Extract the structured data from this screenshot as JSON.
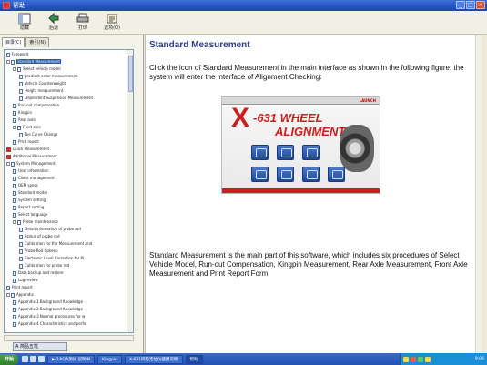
{
  "window": {
    "title": "帮助"
  },
  "toolbar": {
    "buttons": [
      {
        "label": "隐藏",
        "icon": "hide-icon"
      },
      {
        "label": "后退",
        "icon": "back-icon"
      },
      {
        "label": "打印",
        "icon": "print-icon"
      },
      {
        "label": "选项(O)",
        "icon": "options-icon"
      }
    ]
  },
  "left_tabs": [
    "目录(C)",
    "索引(N)"
  ],
  "tree": [
    {
      "label": "Foreword",
      "indent": 0,
      "type": "doc"
    },
    {
      "label": "Standard Measurement",
      "indent": 0,
      "type": "folder",
      "selected": true
    },
    {
      "label": "Select vehicle model",
      "indent": 1,
      "type": "folder"
    },
    {
      "label": "gradient order measurement",
      "indent": 2,
      "type": "doc"
    },
    {
      "label": "Vehicle Counterweight",
      "indent": 2,
      "type": "doc"
    },
    {
      "label": "Height measurement",
      "indent": 2,
      "type": "doc"
    },
    {
      "label": "Dependent Suspension Measurement",
      "indent": 2,
      "type": "doc"
    },
    {
      "label": "Run-out compensation",
      "indent": 1,
      "type": "doc"
    },
    {
      "label": "Kingpin",
      "indent": 1,
      "type": "doc"
    },
    {
      "label": "Rear axle",
      "indent": 1,
      "type": "doc"
    },
    {
      "label": "Front axle",
      "indent": 1,
      "type": "folder"
    },
    {
      "label": "Toe Curve Change",
      "indent": 2,
      "type": "doc"
    },
    {
      "label": "Print report",
      "indent": 1,
      "type": "doc"
    },
    {
      "label": "Quick Measurement",
      "indent": 0,
      "type": "book"
    },
    {
      "label": "Additional Measurement",
      "indent": 0,
      "type": "book"
    },
    {
      "label": "System Management",
      "indent": 0,
      "type": "folder"
    },
    {
      "label": "User information",
      "indent": 1,
      "type": "doc"
    },
    {
      "label": "Client management",
      "indent": 1,
      "type": "doc"
    },
    {
      "label": "OEM specs",
      "indent": 1,
      "type": "doc"
    },
    {
      "label": "Standard model",
      "indent": 1,
      "type": "doc"
    },
    {
      "label": "System setting",
      "indent": 1,
      "type": "doc"
    },
    {
      "label": "Report setting",
      "indent": 1,
      "type": "doc"
    },
    {
      "label": "Select language",
      "indent": 1,
      "type": "doc"
    },
    {
      "label": "Probe maintenance",
      "indent": 1,
      "type": "folder"
    },
    {
      "label": "Detail information of probe rod",
      "indent": 2,
      "type": "doc"
    },
    {
      "label": "Status of probe rod",
      "indent": 2,
      "type": "doc"
    },
    {
      "label": "Calibration for the Measurement And",
      "indent": 2,
      "type": "doc"
    },
    {
      "label": "Probe Rod Upkeep",
      "indent": 2,
      "type": "doc"
    },
    {
      "label": "Electronic Level Correction for Pr",
      "indent": 2,
      "type": "doc"
    },
    {
      "label": "Calibration for probe rod",
      "indent": 2,
      "type": "doc"
    },
    {
      "label": "Data backup and restore",
      "indent": 1,
      "type": "doc"
    },
    {
      "label": "Log review",
      "indent": 1,
      "type": "doc"
    },
    {
      "label": "Print report",
      "indent": 0,
      "type": "doc"
    },
    {
      "label": "Appendix",
      "indent": 0,
      "type": "folder"
    },
    {
      "label": "Appendix 1 Background Knowledge",
      "indent": 1,
      "type": "doc"
    },
    {
      "label": "Appendix 2 Background Knowledge",
      "indent": 1,
      "type": "doc"
    },
    {
      "label": "Appendix 3 Normal procedures for w",
      "indent": 1,
      "type": "doc"
    },
    {
      "label": "Appendix 4 Characteristics and perfo",
      "indent": 1,
      "type": "doc"
    }
  ],
  "langbar": "A 简品五笔",
  "content": {
    "title": "Standard Measurement",
    "intro": "Click the icon of Standard Measurement in the main interface as shown in the following figure, the system will enter the interface of Alignment Checking:",
    "figure": {
      "brand": "LAUNCH",
      "line1": "-631 WHEEL",
      "line2": "ALIGNMENT",
      "x_letter": "X"
    },
    "body": "Standard Measurement is the main part of this software, which includes six procedures of Select Vehicle Model, Run-out Compensation, Kingpin Measurement, Rear Axle Measurement, Front Axle Measurement and Print Report Form"
  },
  "taskbar": {
    "start": "开始",
    "tasks": [
      {
        "label": "▶ 1#QA测试 说明书",
        "active": false
      },
      {
        "label": "Kingpin",
        "active": false
      },
      {
        "label": "X-631四轮定位仪使用说明",
        "active": false
      },
      {
        "label": "帮助",
        "active": true
      }
    ],
    "clock": "9:06"
  }
}
